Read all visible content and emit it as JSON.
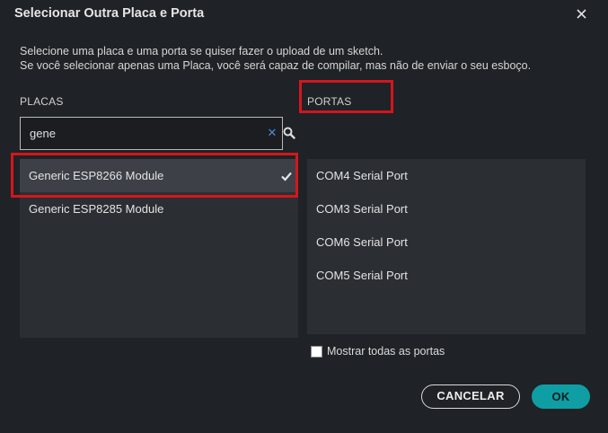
{
  "dialog": {
    "title": "Selecionar Outra Placa e Porta",
    "close_icon": "close-icon",
    "description_line1": "Selecione uma placa e uma porta se quiser fazer o upload de um sketch.",
    "description_line2": "Se você selecionar apenas uma Placa, você será capaz de compilar, mas não de enviar o seu esboço."
  },
  "boards": {
    "label": "PLACAS",
    "search": {
      "value": "gene",
      "placeholder": "",
      "clear_icon": "clear-icon",
      "search_icon": "search-icon"
    },
    "items": [
      {
        "label": "Generic ESP8266 Module",
        "selected": true
      },
      {
        "label": "Generic ESP8285 Module",
        "selected": false
      }
    ]
  },
  "ports": {
    "label": "PORTAS",
    "items": [
      {
        "label": "COM4 Serial Port"
      },
      {
        "label": "COM3 Serial Port"
      },
      {
        "label": "COM6 Serial Port"
      },
      {
        "label": "COM5 Serial Port"
      }
    ],
    "show_all_label": "Mostrar todas as portas",
    "show_all_checked": false
  },
  "buttons": {
    "cancel": "CANCELAR",
    "ok": "OK"
  },
  "colors": {
    "background": "#1f2226",
    "list_background": "#2b2e33",
    "selected_row": "#3d4047",
    "accent": "#0f9ea3",
    "highlight": "#d4161d",
    "clear_icon": "#4c8bd6"
  }
}
